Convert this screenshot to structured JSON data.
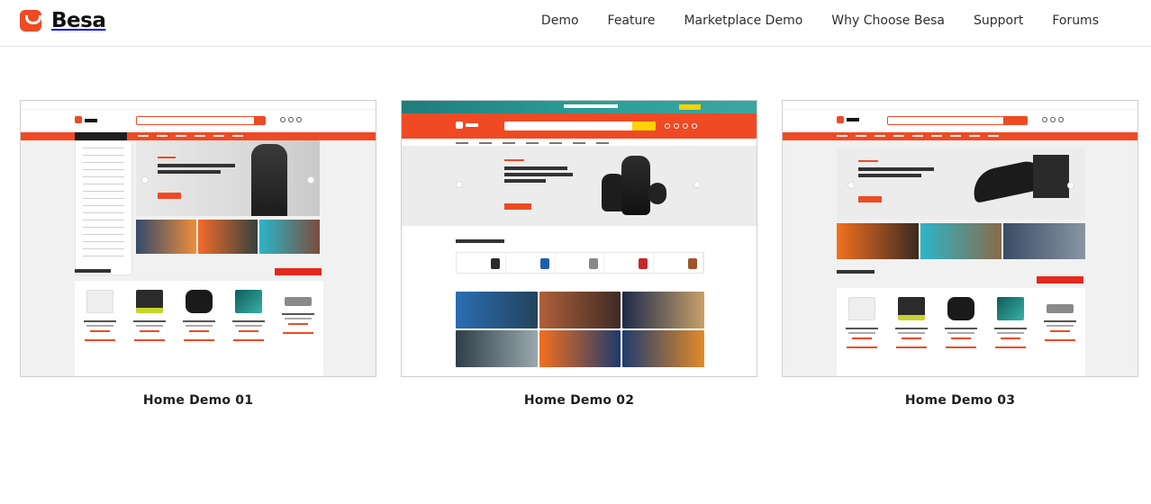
{
  "brand": {
    "name": "Besa",
    "accent": "#ef4a23"
  },
  "nav": {
    "items": [
      "Demo",
      "Feature",
      "Marketplace Demo",
      "Why Choose Besa",
      "Support",
      "Forums"
    ]
  },
  "demos": [
    {
      "caption": "Home Demo 01"
    },
    {
      "caption": "Home Demo 02"
    },
    {
      "caption": "Home Demo 03"
    }
  ]
}
